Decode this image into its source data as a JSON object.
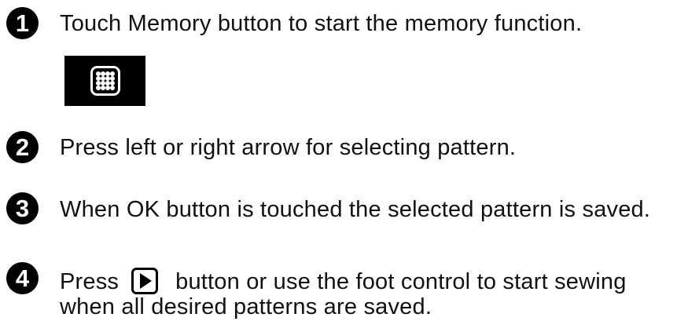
{
  "steps": [
    {
      "number": "1",
      "text": "Touch Memory button to start the memory function."
    },
    {
      "number": "2",
      "text": "Press left or right arrow for selecting pattern."
    },
    {
      "number": "3",
      "text": "When OK button is touched the selected pattern is saved."
    },
    {
      "number": "4",
      "text_before": "Press",
      "text_after": "button or use the foot control to start sewing",
      "text_line2": "when all desired patterns are saved."
    }
  ],
  "icons": {
    "memory_button": "memory-grid-icon",
    "play_button": "play-icon"
  }
}
